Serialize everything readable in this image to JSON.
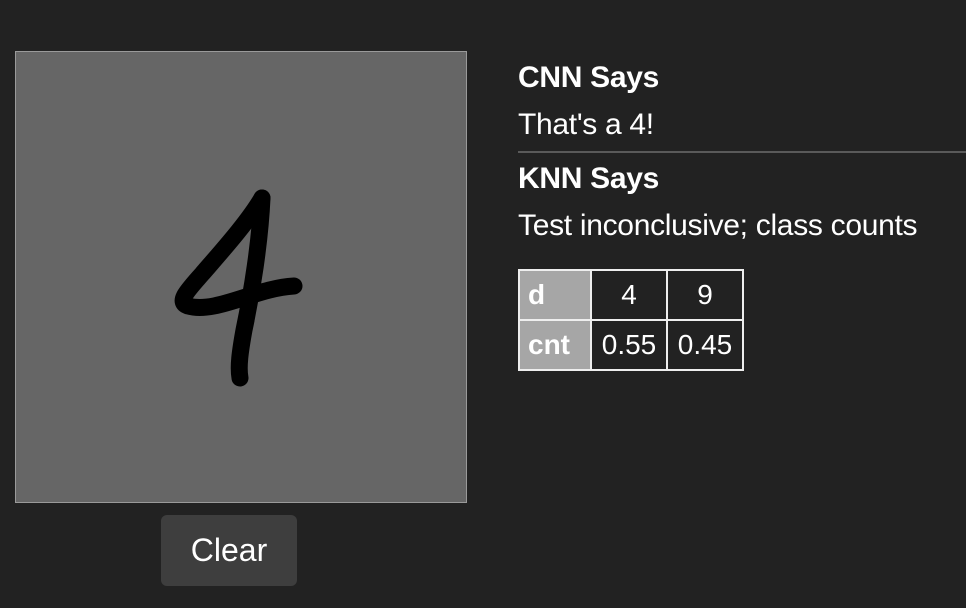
{
  "drawing": {
    "digit_drawn": "4"
  },
  "controls": {
    "clear_label": "Clear"
  },
  "cnn": {
    "heading": "CNN Says",
    "verdict": "That's a 4!"
  },
  "knn": {
    "heading": "KNN Says",
    "verdict": "Test inconclusive; class counts",
    "table": {
      "row_headers": [
        "d",
        "cnt"
      ],
      "digits": [
        "4",
        "9"
      ],
      "counts": [
        "0.55",
        "0.45"
      ]
    }
  },
  "colors": {
    "background": "#222222",
    "canvas": "#666666",
    "table_header_bg": "#a6a6a6",
    "button_bg": "#3e3e3e"
  }
}
